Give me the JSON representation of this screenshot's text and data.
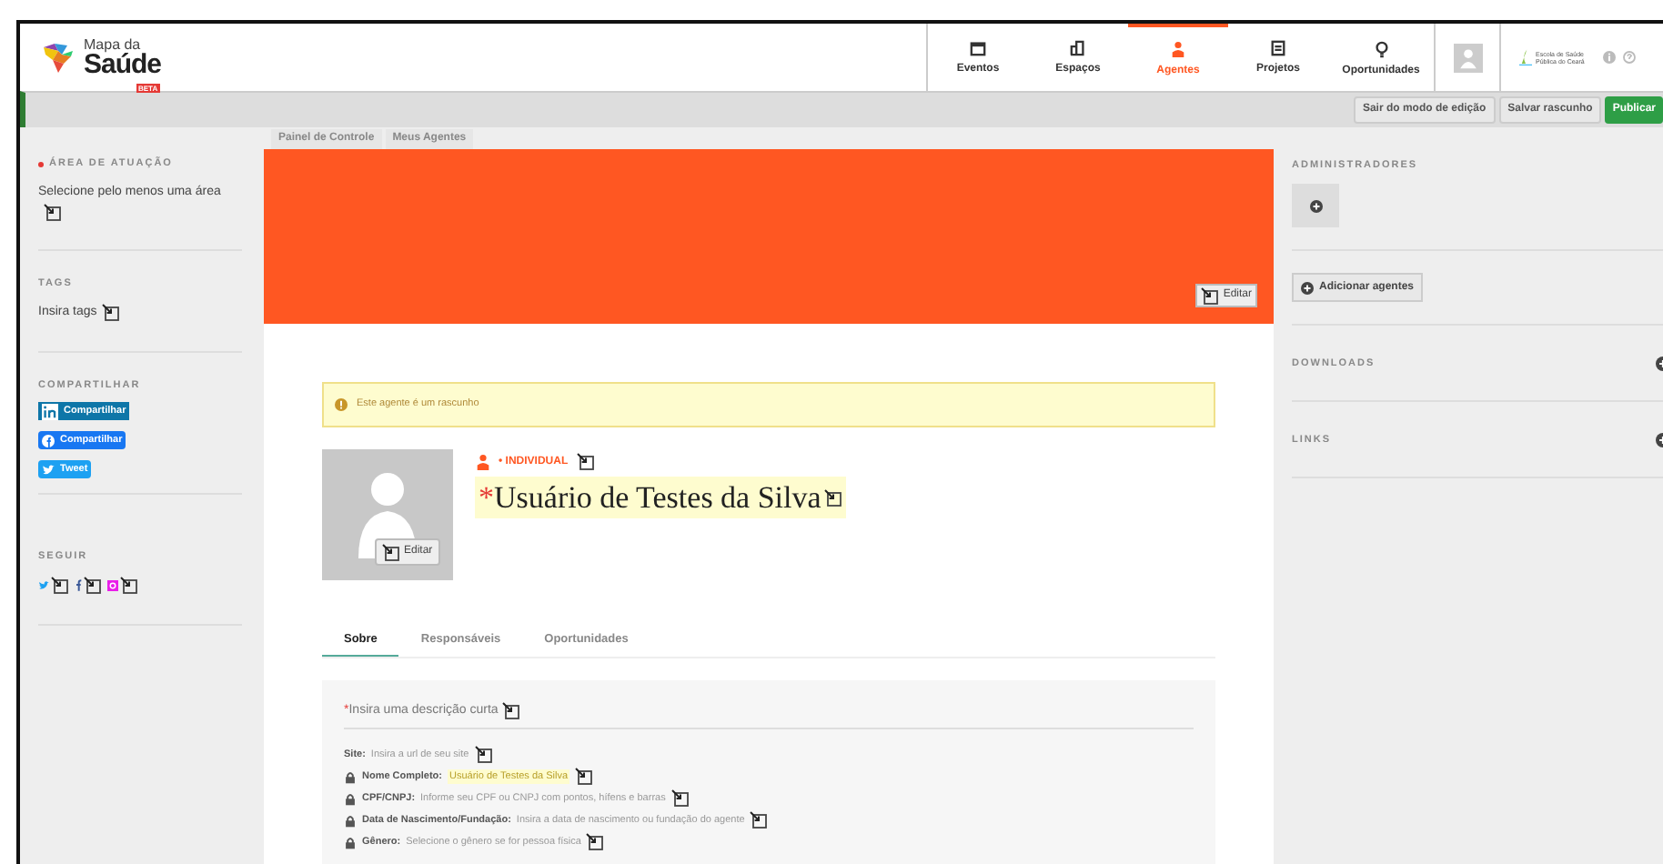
{
  "logo": {
    "line1": "Mapa da",
    "line2": "Saúde",
    "badge": "BETA"
  },
  "nav": [
    {
      "label": "Eventos",
      "kind": "calendar",
      "selected": false
    },
    {
      "label": "Espaços",
      "kind": "building",
      "selected": false
    },
    {
      "label": "Agentes",
      "kind": "person",
      "selected": true
    },
    {
      "label": "Projetos",
      "kind": "file",
      "selected": false
    },
    {
      "label": "Oportunidades",
      "kind": "bulb",
      "selected": false
    }
  ],
  "partner": {
    "line1": "Escola de Saúde",
    "line2": "Pública do Ceará"
  },
  "edit_bar": {
    "buttons": [
      {
        "label": "Sair do modo de edição",
        "kind": "plain"
      },
      {
        "label": "Salvar rascunho",
        "kind": "plain"
      },
      {
        "label": "Publicar",
        "kind": "primary"
      }
    ]
  },
  "breadcrumb": [
    "Painel de Controle",
    "Meus Agentes"
  ],
  "left_sidebar": {
    "area": {
      "title": "ÁREA DE ATUAÇÃO",
      "required": true,
      "placeholder": "Selecione pelo menos uma área"
    },
    "tags": {
      "title": "TAGS",
      "placeholder": "Insira tags"
    },
    "share": {
      "title": "COMPARTILHAR",
      "buttons": [
        {
          "kind": "linkedin",
          "label": "Compartilhar"
        },
        {
          "kind": "facebook",
          "label": "Compartilhar"
        },
        {
          "kind": "twitter",
          "label": "Tweet"
        }
      ]
    },
    "follow": {
      "title": "SEGUIR",
      "networks": [
        {
          "kind": "twitter"
        },
        {
          "kind": "facebook"
        },
        {
          "kind": "instagram"
        }
      ]
    }
  },
  "cover": {
    "edit_label": "Editar"
  },
  "notice": "Este agente é um rascunho",
  "agent": {
    "type_mark": "•",
    "type": "INDIVIDUAL",
    "name_mark": "*",
    "name": "Usuário de Testes da Silva",
    "avatar_edit": "Editar"
  },
  "tabs": [
    {
      "label": "Sobre",
      "selected": true
    },
    {
      "label": "Responsáveis",
      "selected": false
    },
    {
      "label": "Oportunidades",
      "selected": false
    }
  ],
  "about": {
    "description_mark": "*",
    "description_placeholder": "Insira uma descrição curta",
    "fields": [
      {
        "label": "Site:",
        "value": "Insira a url de seu site",
        "locked": false,
        "filled": false
      },
      {
        "label": "Nome Completo:",
        "value": "Usuário de Testes da Silva",
        "locked": true,
        "filled": true
      },
      {
        "label": "CPF/CNPJ:",
        "value": "Informe seu CPF ou CNPJ com pontos, hífens e barras",
        "locked": true,
        "filled": false
      },
      {
        "label": "Data de Nascimento/Fundação:",
        "value": "Insira a data de nascimento ou fundação do agente",
        "locked": true,
        "filled": false
      },
      {
        "label": "Gênero:",
        "value": "Selecione o gênero se for pessoa física",
        "locked": true,
        "filled": false
      }
    ]
  },
  "right_sidebar": {
    "admins_title": "ADMINISTRADORES",
    "add_agents": "Adicionar agentes",
    "downloads_title": "DOWNLOADS",
    "links_title": "LINKS"
  }
}
